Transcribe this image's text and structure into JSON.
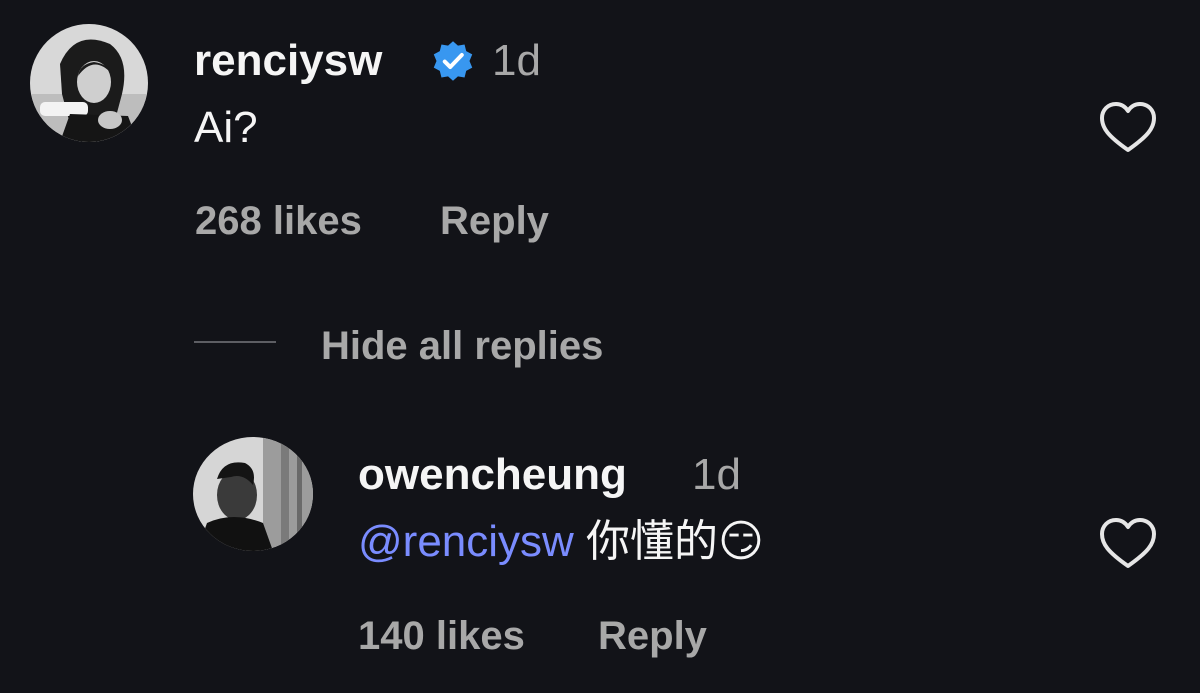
{
  "comment": {
    "username": "renciysw",
    "time": "1d",
    "text": "Ai?",
    "likes": "268 likes",
    "reply_label": "Reply",
    "verified_icon": "verified-badge-icon",
    "like_icon": "heart-outline-icon"
  },
  "replies_toggle": {
    "label": "Hide all replies"
  },
  "reply": {
    "username": "owencheung",
    "time": "1d",
    "mention": "@renciysw",
    "text": " 你懂的😏",
    "likes": "140 likes",
    "reply_label": "Reply",
    "like_icon": "heart-outline-icon"
  },
  "colors": {
    "background": "#121318",
    "mention": "#7a8cff",
    "verified": "#3897f0",
    "muted": "#a8a8a8"
  }
}
